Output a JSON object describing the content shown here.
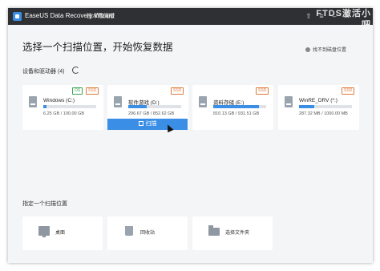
{
  "window": {
    "app_title": "EaseUS Data Recovery Wizard",
    "edition": "技术赠阅版",
    "watermark": "FTDS激活小吧"
  },
  "titlebar_buttons": [
    {
      "name": "upload-icon",
      "glyph": "⇧"
    },
    {
      "name": "menu-icon",
      "glyph": "≡"
    },
    {
      "name": "minimize-icon",
      "glyph": "–"
    },
    {
      "name": "close-icon",
      "glyph": "✕"
    }
  ],
  "page": {
    "title": "选择一个扫描位置，开始恢复数据",
    "help_link": "找不到磁盘位置"
  },
  "drives_section": {
    "label": "设备和驱动器 (4)"
  },
  "drives": [
    {
      "name": "Windows (C:)",
      "size": "6.25 GB / 100.00 GB",
      "used_fraction": 0.0625,
      "badges": [
        "OS",
        "SSD"
      ]
    },
    {
      "name": "软件游戏 (D:)",
      "size": "296.67 GB / 852.62 GB",
      "used_fraction": 0.348,
      "badges": [
        "SSD"
      ]
    },
    {
      "name": "资料存储 (E:)",
      "size": "810.13 GB / 931.51 GB",
      "used_fraction": 0.87,
      "badges": [
        "SSD"
      ]
    },
    {
      "name": "WinRE_DRV (*:)",
      "size": "287.32 MB / 1000.00 MB",
      "used_fraction": 0.287,
      "badges": [
        "SSD"
      ]
    }
  ],
  "scan_button": {
    "label": "扫描"
  },
  "locations_section": {
    "label": "指定一个扫描位置"
  },
  "locations": [
    {
      "label": "桌面",
      "icon": "desktop-icon"
    },
    {
      "label": "回收站",
      "icon": "recycle-bin-icon"
    },
    {
      "label": "选择文件夹",
      "icon": "folder-icon"
    }
  ],
  "colors": {
    "accent": "#3a8ee6",
    "titlebar": "#2f3033",
    "background": "#f4f5f7",
    "badge_os": "#3aa350",
    "badge_ssd": "#e07a3a"
  }
}
